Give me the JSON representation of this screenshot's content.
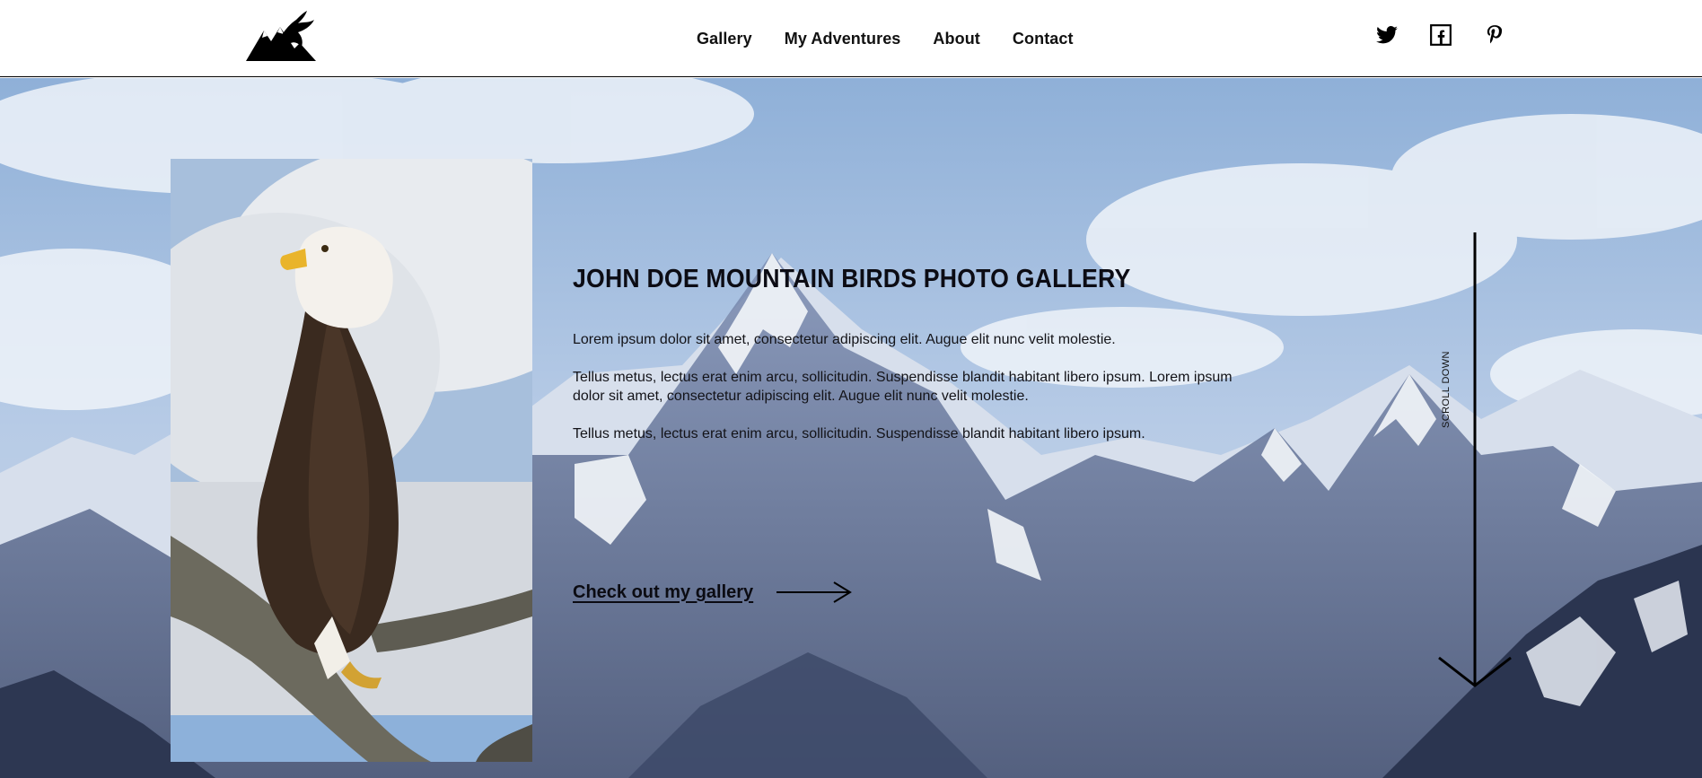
{
  "header": {
    "logo_icon": "mountain-eagle-logo-icon",
    "nav": [
      {
        "label": "Gallery"
      },
      {
        "label": "My Adventures"
      },
      {
        "label": "About"
      },
      {
        "label": "Contact"
      }
    ],
    "social": [
      "twitter-icon",
      "facebook-icon",
      "pinterest-icon"
    ]
  },
  "hero": {
    "title": "JOHN DOE MOUNTAIN BIRDS PHOTO GALLERY",
    "paragraphs": [
      "Lorem ipsum dolor sit amet, consectetur adipiscing elit. Augue elit nunc velit molestie.",
      "Tellus metus, lectus erat enim arcu, sollicitudin. Suspendisse blandit habitant libero ipsum. Lorem ipsum dolor sit amet, consectetur adipiscing elit. Augue elit nunc velit molestie.",
      "Tellus metus, lectus erat enim arcu, sollicitudin. Suspendisse blandit habitant libero ipsum."
    ],
    "cta_label": "Check out my gallery",
    "scroll_label": "SCROLL DOWN"
  },
  "colors": {
    "sky": "#a9c3e3",
    "snow": "#eef2f7",
    "rock": "#46557a",
    "text": "#111111"
  }
}
